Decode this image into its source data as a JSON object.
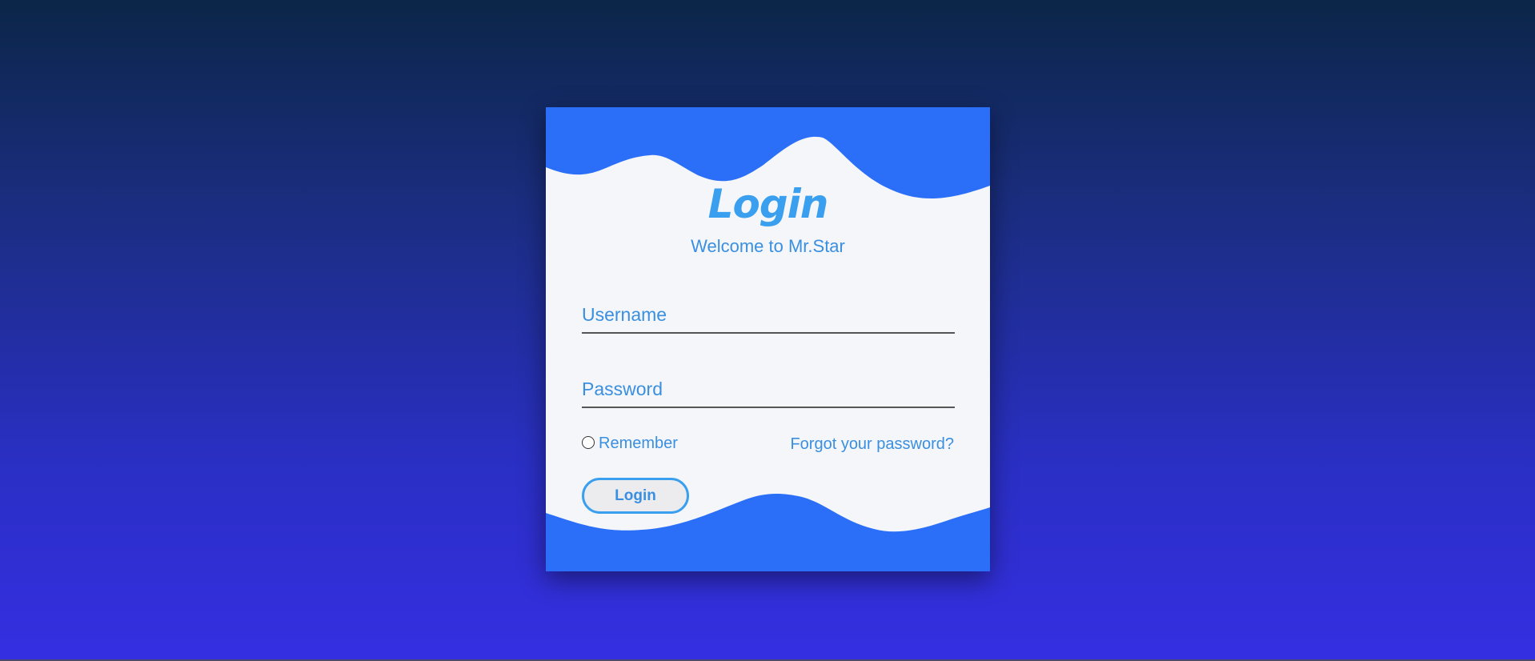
{
  "login": {
    "title": "Login",
    "subtitle": "Welcome to Mr.Star",
    "username_placeholder": "Username",
    "password_placeholder": "Password",
    "remember_label": "Remember",
    "forgot_link": "Forgot your password?",
    "submit_label": "Login"
  },
  "colors": {
    "accent": "#3a9fee",
    "wave": "#2b6ff8",
    "card_background": "#f4f6f9"
  }
}
